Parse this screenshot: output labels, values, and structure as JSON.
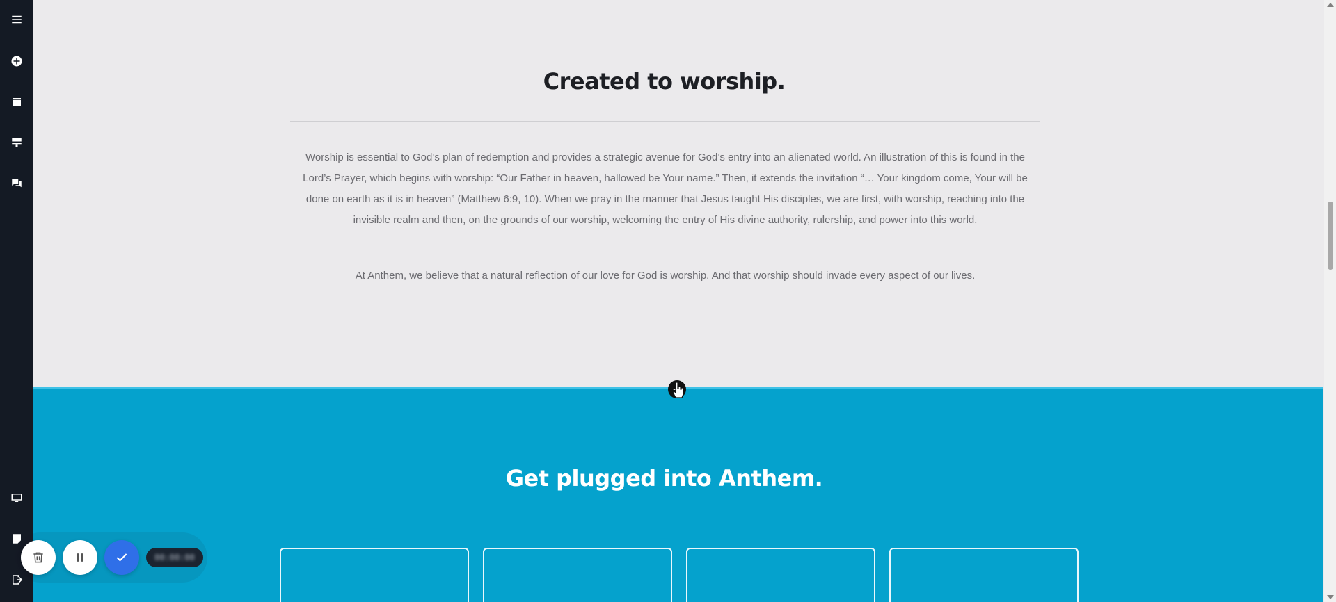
{
  "sidebar": {
    "icons": [
      "menu-icon",
      "add-circle-icon",
      "layers-icon",
      "layout-icon",
      "comments-icon",
      "desktop-icon",
      "page-icon",
      "exit-icon"
    ]
  },
  "worship": {
    "title": "Created to worship.",
    "paragraph1": "Worship is essential to God’s plan of redemption and provides a strategic avenue for God’s entry into an alienated world. An illustration of this is found in the Lord’s Prayer, which begins with worship: “Our Father in heaven, hallowed be Your name.” Then, it extends the invitation “… Your kingdom come, Your will be done on earth as it is in heaven” (Matthew 6:9, 10). When we pray in the manner that Jesus taught His disciples, we are first, with worship, reaching into the invisible realm and then, on the grounds of our worship, welcoming the entry of His divine authority, rulership, and power into this world.",
    "paragraph2": "At Anthem, we believe that a natural reflection of our love for God is worship. And that worship should invade every aspect of our lives."
  },
  "plugged": {
    "title": "Get plugged into Anthem.",
    "card_count": 4
  },
  "recorder": {
    "timer": "00:00:00"
  },
  "colors": {
    "sidebar": "#141a24",
    "page_bg": "#ebeaec",
    "section_blue": "#05a2cd",
    "confirm_blue": "#2f6fe8"
  }
}
